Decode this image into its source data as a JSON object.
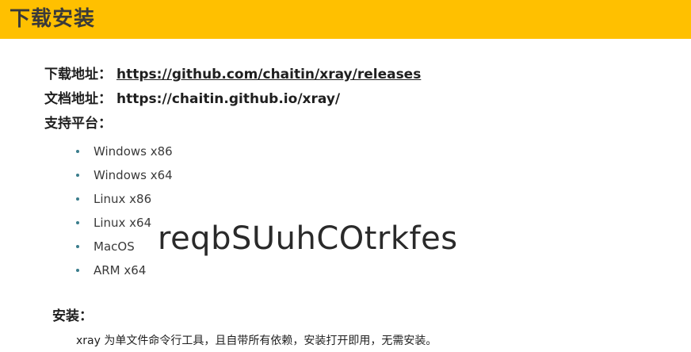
{
  "header": {
    "title": "下载安装",
    "bar_color": "#ffc000"
  },
  "download": {
    "label": "下载地址：",
    "url": "https://github.com/chaitin/xray/releases"
  },
  "docs": {
    "label": "文档地址：",
    "url": "https://chaitin.github.io/xray/"
  },
  "platforms": {
    "label": "支持平台：",
    "items": [
      "Windows x86",
      "Windows x64",
      "Linux x86",
      "Linux x64",
      "MacOS",
      "ARM x64"
    ]
  },
  "overlay_text": "reqbSUuhCOtrkfes",
  "install": {
    "heading": "安装：",
    "description": "xray 为单文件命令行工具，且自带所有依赖，安装打开即用，无需安装。"
  }
}
